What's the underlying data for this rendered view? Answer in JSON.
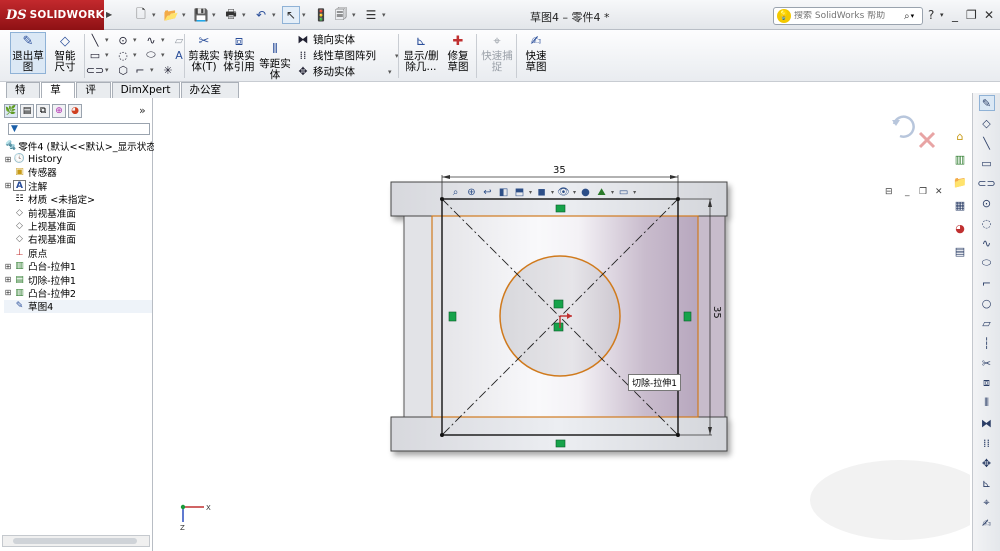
{
  "app": {
    "logo_ds": "DS",
    "logo_text": "SOLIDWORKS",
    "doc_title": "草图4 – 零件4 *",
    "search_placeholder": "搜索 SolidWorks 帮助"
  },
  "command_manager": {
    "exit_sketch": "退出草图",
    "smart_dimension": "智能尺寸",
    "trim": "剪裁实体(T)",
    "convert": "转换实体引用",
    "offset": "等距实体",
    "mirror": "镜向实体",
    "linear_pattern": "线性草图阵列",
    "move": "移动实体",
    "display_delete": "显示/删除几...",
    "repair": "修复草图",
    "quick_snaps": "快速捕捉",
    "rapid_sketch": "快速草图"
  },
  "tabs": [
    {
      "label": "特征"
    },
    {
      "label": "草图"
    },
    {
      "label": "评估"
    },
    {
      "label": "DimXpert"
    },
    {
      "label": "办公室产品"
    }
  ],
  "feature_tree": {
    "root": "零件4 (默认<<默认>_显示状态",
    "items": [
      {
        "label": "History",
        "icon": "history-icon"
      },
      {
        "label": "传感器",
        "icon": "sensor-icon"
      },
      {
        "label": "注解",
        "icon": "annotation-icon"
      },
      {
        "label": "材质 <未指定>",
        "icon": "material-icon"
      },
      {
        "label": "前视基准面",
        "icon": "plane-icon"
      },
      {
        "label": "上视基准面",
        "icon": "plane-icon"
      },
      {
        "label": "右视基准面",
        "icon": "plane-icon"
      },
      {
        "label": "原点",
        "icon": "origin-icon"
      },
      {
        "label": "凸台-拉伸1",
        "icon": "extrude-icon"
      },
      {
        "label": "切除-拉伸1",
        "icon": "cut-extrude-icon"
      },
      {
        "label": "凸台-拉伸2",
        "icon": "extrude-icon"
      },
      {
        "label": "草图4",
        "icon": "sketch-icon"
      }
    ]
  },
  "sketch": {
    "dim_horizontal": "35",
    "dim_vertical": "35",
    "tooltip": "切除-拉伸1"
  },
  "colors": {
    "accent_sketch": "#d07a1e",
    "relation_green": "#16a34a",
    "confirm_red": "#e34b4b"
  }
}
